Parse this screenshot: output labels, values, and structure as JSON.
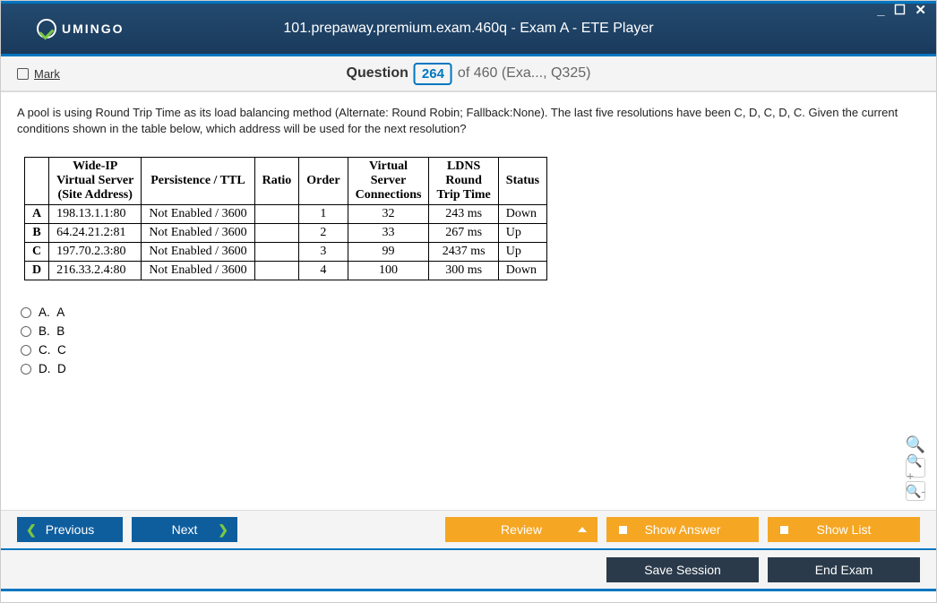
{
  "window": {
    "logo_text": "UMINGO",
    "title": "101.prepaway.premium.exam.460q - Exam A - ETE Player",
    "controls": "_ ☐ ✕"
  },
  "header": {
    "mark_label": "Mark",
    "question_word": "Question",
    "question_number": "264",
    "of_text": "of 460 (Exa..., Q325)"
  },
  "question_text": "A pool is using Round Trip Time as its load balancing method (Alternate: Round Robin; Fallback:None). The last five resolutions have been C, D, C, D, C. Given the current conditions shown in the table below, which address will be used for the next resolution?",
  "table": {
    "headers": [
      "",
      "Wide-IP Virtual Server (Site Address)",
      "Persistence / TTL",
      "Ratio",
      "Order",
      "Virtual Server Connections",
      "LDNS Round Trip Time",
      "Status"
    ],
    "rows": [
      {
        "lbl": "A",
        "addr": "198.13.1.1:80",
        "pers": "Not Enabled / 3600",
        "ratio": "",
        "order": "1",
        "conn": "32",
        "rtt": "243 ms",
        "status": "Down"
      },
      {
        "lbl": "B",
        "addr": "64.24.21.2:81",
        "pers": "Not Enabled / 3600",
        "ratio": "",
        "order": "2",
        "conn": "33",
        "rtt": "267 ms",
        "status": "Up"
      },
      {
        "lbl": "C",
        "addr": "197.70.2.3:80",
        "pers": "Not Enabled / 3600",
        "ratio": "",
        "order": "3",
        "conn": "99",
        "rtt": "2437 ms",
        "status": "Up"
      },
      {
        "lbl": "D",
        "addr": "216.33.2.4:80",
        "pers": "Not Enabled / 3600",
        "ratio": "",
        "order": "4",
        "conn": "100",
        "rtt": "300 ms",
        "status": "Down"
      }
    ]
  },
  "answers": [
    {
      "letter": "A.",
      "text": "A"
    },
    {
      "letter": "B.",
      "text": "B"
    },
    {
      "letter": "C.",
      "text": "C"
    },
    {
      "letter": "D.",
      "text": "D"
    }
  ],
  "footer": {
    "previous": "Previous",
    "next": "Next",
    "review": "Review",
    "show_answer": "Show Answer",
    "show_list": "Show List",
    "save_session": "Save Session",
    "end_exam": "End Exam"
  }
}
